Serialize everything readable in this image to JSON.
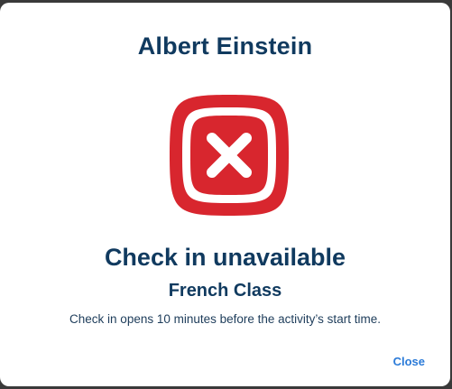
{
  "dialog": {
    "person_name": "Albert Einstein",
    "status_icon": "error-x-icon",
    "status_color": "#d8262e",
    "title": "Check in unavailable",
    "activity": "French Class",
    "message": "Check in opens 10 minutes before the activity’s start time.",
    "close_label": "Close"
  }
}
